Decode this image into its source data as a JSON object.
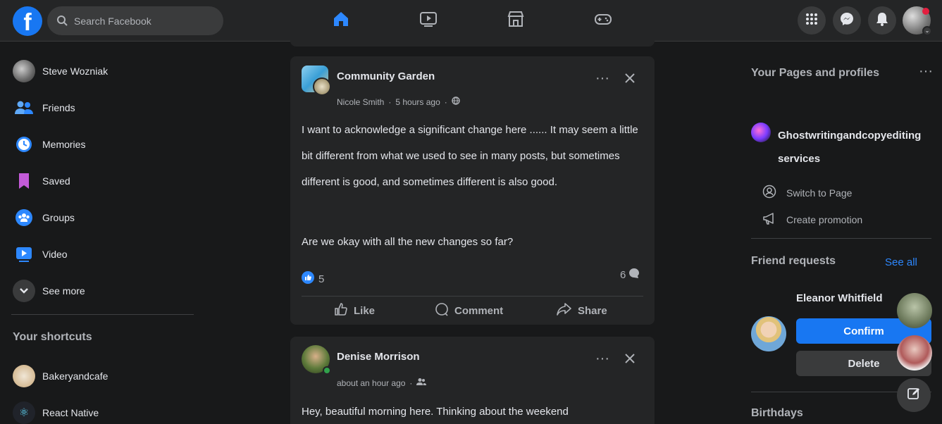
{
  "topbar": {
    "search_placeholder": "Search Facebook",
    "nav": [
      {
        "name": "home-icon",
        "active": true
      },
      {
        "name": "watch-icon",
        "active": false
      },
      {
        "name": "marketplace-icon",
        "active": false
      },
      {
        "name": "gaming-icon",
        "active": false
      }
    ],
    "right_icons": [
      "menu-grid-icon",
      "messenger-icon",
      "bell-icon"
    ]
  },
  "sidebar": {
    "items": [
      {
        "label": "Steve Wozniak",
        "icon": "avatar"
      },
      {
        "label": "Friends",
        "icon": "friends-icon"
      },
      {
        "label": "Memories",
        "icon": "clock-icon"
      },
      {
        "label": "Saved",
        "icon": "bookmark-icon"
      },
      {
        "label": "Groups",
        "icon": "groups-icon"
      },
      {
        "label": "Video",
        "icon": "video-icon"
      },
      {
        "label": "See more",
        "icon": "chevron-down-icon"
      }
    ],
    "shortcuts_heading": "Your shortcuts",
    "shortcuts": [
      {
        "label": "Bakeryandcafe"
      },
      {
        "label": "React Native"
      }
    ]
  },
  "feed": {
    "post1": {
      "author": "Community Garden",
      "sub": "Nicole Smith",
      "time": "5 hours ago",
      "paragraph": "I want to acknowledge a significant change here ...... It may seem a little bit different from what we used to see in many posts, but sometimes different is good, and sometimes different is also good.",
      "question": "Are we okay with all the new changes so far?",
      "likes": "5",
      "comments": "6",
      "like_label": "Like",
      "comment_label": "Comment",
      "share_label": "Share"
    },
    "post2": {
      "author": "Denise Morrison",
      "time": "about an hour ago",
      "snippet": "Hey, beautiful morning here. Thinking about the weekend"
    }
  },
  "right": {
    "pages_heading": "Your Pages and profiles",
    "page_name": "Ghostwritingandcopyediting services",
    "switch_label": "Switch to Page",
    "promote_label": "Create promotion",
    "requests_heading": "Friend requests",
    "see_all": "See all",
    "requester_name": "Eleanor Whitfield",
    "confirm": "Confirm",
    "delete": "Delete",
    "birthdays_heading": "Birthdays"
  },
  "colors": {
    "accent": "#1877f2",
    "bg": "#18191a",
    "card": "#242526"
  }
}
